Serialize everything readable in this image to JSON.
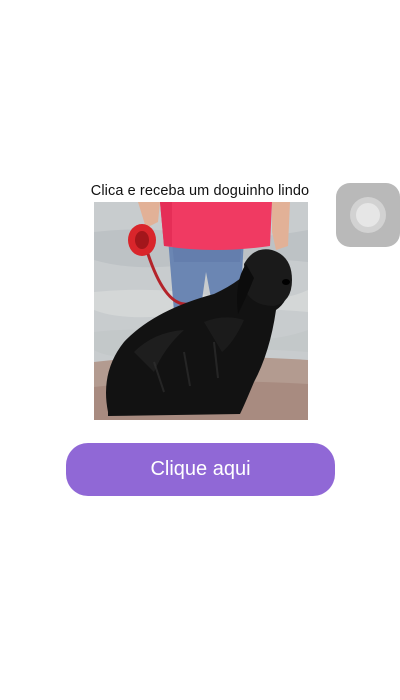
{
  "screen": {
    "caption": "Clica e receba um doguinho lindo",
    "button_label": "Clique aqui",
    "photo_subject": "black dog on a red leash held by a person in a pink shirt",
    "colors": {
      "button": "#9068d6",
      "button_text": "#ffffff",
      "background": "#ffffff",
      "assistive_touch": "#b9b9b9"
    },
    "icons": {
      "floating_control": "assistive-touch-icon"
    }
  }
}
